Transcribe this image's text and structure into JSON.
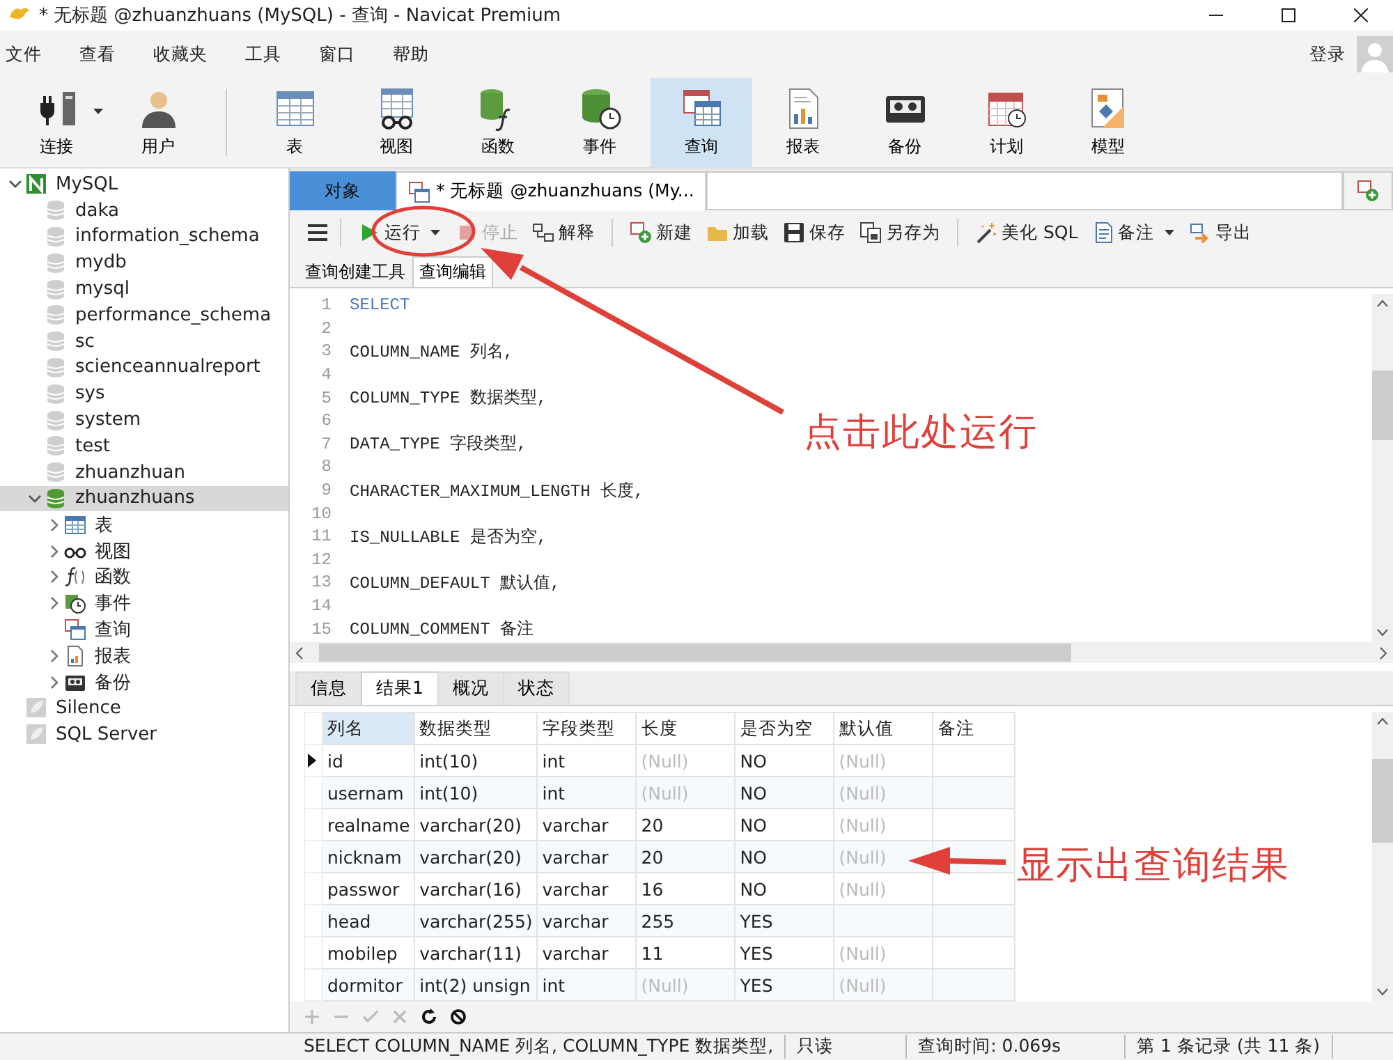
{
  "window": {
    "title": "* 无标题 @zhuanzhuans (MySQL) - 查询 - Navicat Premium"
  },
  "menu": [
    "文件",
    "查看",
    "收藏夹",
    "工具",
    "窗口",
    "帮助"
  ],
  "login": "登录",
  "toolbar": [
    {
      "label": "连接",
      "dropdown": true,
      "selected": false
    },
    {
      "label": "用户",
      "selected": false
    },
    {
      "label": "表",
      "selected": false
    },
    {
      "label": "视图",
      "selected": false
    },
    {
      "label": "函数",
      "selected": false
    },
    {
      "label": "事件",
      "selected": false
    },
    {
      "label": "查询",
      "selected": true
    },
    {
      "label": "报表",
      "selected": false
    },
    {
      "label": "备份",
      "selected": false
    },
    {
      "label": "计划",
      "selected": false
    },
    {
      "label": "模型",
      "selected": false
    }
  ],
  "tree": [
    {
      "label": "MySQL",
      "kind": "connection",
      "connected": true,
      "expanded": true,
      "selected": false,
      "children": [
        {
          "label": "daka",
          "kind": "database",
          "selected": false
        },
        {
          "label": "information_schema",
          "kind": "database",
          "selected": false
        },
        {
          "label": "mydb",
          "kind": "database",
          "selected": false
        },
        {
          "label": "mysql",
          "kind": "database",
          "selected": false
        },
        {
          "label": "performance_schema",
          "kind": "database",
          "selected": false
        },
        {
          "label": "sc",
          "kind": "database",
          "selected": false
        },
        {
          "label": "scienceannualreport",
          "kind": "database",
          "selected": false
        },
        {
          "label": "sys",
          "kind": "database",
          "selected": false
        },
        {
          "label": "system",
          "kind": "database",
          "selected": false
        },
        {
          "label": "test",
          "kind": "database",
          "selected": false
        },
        {
          "label": "zhuanzhuan",
          "kind": "database",
          "selected": false
        },
        {
          "label": "zhuanzhuans",
          "kind": "database",
          "expanded": true,
          "selected": true,
          "children": [
            {
              "label": "表",
              "kind": "folder",
              "expanded": false,
              "selected": false
            },
            {
              "label": "视图",
              "kind": "folder",
              "expanded": false,
              "selected": false
            },
            {
              "label": "函数",
              "kind": "folder",
              "expanded": false,
              "selected": false
            },
            {
              "label": "事件",
              "kind": "folder",
              "expanded": false,
              "selected": false
            },
            {
              "label": "查询",
              "kind": "folder",
              "selected": false
            },
            {
              "label": "报表",
              "kind": "folder",
              "expanded": false,
              "selected": false
            },
            {
              "label": "备份",
              "kind": "folder",
              "expanded": false,
              "selected": false
            }
          ]
        }
      ]
    },
    {
      "label": "Silence",
      "kind": "connection",
      "connected": false,
      "selected": false
    },
    {
      "label": "SQL Server",
      "kind": "connection",
      "connected": false,
      "selected": false
    }
  ],
  "object_tab": "对象",
  "tabs": [
    {
      "label": "* 无标题 @zhuanzhuans (My...",
      "selected": true
    }
  ],
  "query_toolbar": [
    {
      "label": "运行",
      "dropdown": true,
      "disabled": false
    },
    {
      "label": "停止",
      "disabled": true
    },
    {
      "label": "解释",
      "disabled": false
    },
    {
      "label": "新建",
      "disabled": false
    },
    {
      "label": "加载",
      "disabled": false
    },
    {
      "label": "保存",
      "disabled": false
    },
    {
      "label": "另存为",
      "disabled": false
    },
    {
      "label": "美化 SQL",
      "disabled": false
    },
    {
      "label": "备注",
      "dropdown": true,
      "disabled": false
    },
    {
      "label": "导出",
      "disabled": false
    }
  ],
  "editor_tabs": [
    {
      "label": "查询创建工具",
      "selected": false
    },
    {
      "label": "查询编辑",
      "selected": true
    }
  ],
  "editor": {
    "lines": [
      {
        "number": "1",
        "text": "SELECT",
        "keyword": true
      },
      {
        "number": "2"
      },
      {
        "number": "3",
        "text": "COLUMN_NAME 列名,"
      },
      {
        "number": "4"
      },
      {
        "number": "5",
        "text": "COLUMN_TYPE 数据类型,"
      },
      {
        "number": "6"
      },
      {
        "number": "7",
        "text": "DATA_TYPE 字段类型,"
      },
      {
        "number": "8"
      },
      {
        "number": "9",
        "text": "CHARACTER_MAXIMUM_LENGTH 长度,"
      },
      {
        "number": "10"
      },
      {
        "number": "11",
        "text": "IS_NULLABLE 是否为空,"
      },
      {
        "number": "12"
      },
      {
        "number": "13",
        "text": "COLUMN_DEFAULT 默认值,"
      },
      {
        "number": "14"
      },
      {
        "number": "15",
        "text": "COLUMN_COMMENT 备注"
      }
    ]
  },
  "result_tabs": [
    {
      "label": "信息",
      "selected": false
    },
    {
      "label": "结果1",
      "selected": true
    },
    {
      "label": "概况",
      "selected": false
    },
    {
      "label": "状态",
      "selected": false
    }
  ],
  "grid": {
    "columns": [
      {
        "label": "列名",
        "selected": true
      },
      {
        "label": "数据类型",
        "selected": false
      },
      {
        "label": "字段类型",
        "selected": false
      },
      {
        "label": "长度",
        "selected": false
      },
      {
        "label": "是否为空",
        "selected": false
      },
      {
        "label": "默认值",
        "selected": false
      },
      {
        "label": "备注",
        "selected": false
      }
    ],
    "rows": [
      {
        "selected": true,
        "cells": [
          "id",
          "int(10)",
          "int",
          {
            "text": "(Null)",
            "null": true
          },
          "NO",
          {
            "text": "(Null)",
            "null": true
          },
          null
        ]
      },
      {
        "selected": false,
        "cells": [
          "usernam",
          "int(10)",
          "int",
          {
            "text": "(Null)",
            "null": true
          },
          "NO",
          {
            "text": "(Null)",
            "null": true
          },
          null
        ]
      },
      {
        "selected": false,
        "cells": [
          "realname",
          "varchar(20)",
          "varchar",
          "20",
          "NO",
          {
            "text": "(Null)",
            "null": true
          },
          null
        ]
      },
      {
        "selected": false,
        "cells": [
          "nicknam",
          "varchar(20)",
          "varchar",
          "20",
          "NO",
          {
            "text": "(Null)",
            "null": true
          },
          null
        ]
      },
      {
        "selected": false,
        "cells": [
          "passwor",
          "varchar(16)",
          "varchar",
          "16",
          "NO",
          {
            "text": "(Null)",
            "null": true
          },
          null
        ]
      },
      {
        "selected": false,
        "cells": [
          "head",
          "varchar(255)",
          "varchar",
          "255",
          "YES",
          null,
          null
        ]
      },
      {
        "selected": false,
        "cells": [
          "mobilep",
          "varchar(11)",
          "varchar",
          "11",
          "YES",
          {
            "text": "(Null)",
            "null": true
          },
          null
        ]
      },
      {
        "selected": false,
        "cells": [
          "dormitor",
          "int(2) unsign",
          "int",
          {
            "text": "(Null)",
            "null": true
          },
          "YES",
          {
            "text": "(Null)",
            "null": true
          },
          null
        ]
      }
    ]
  },
  "status_bar": [
    "SELECT  COLUMN_NAME 列名,  COLUMN_TYPE 数据类型,",
    "只读",
    "查询时间: 0.069s",
    "第 1 条记录 (共 11 条)"
  ],
  "annotations": [
    "点击此处运行",
    "显示出查询结果"
  ]
}
